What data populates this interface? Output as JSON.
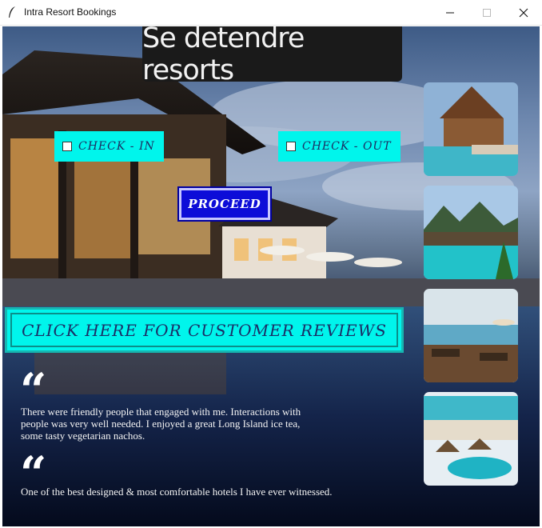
{
  "window": {
    "title": "Intra Resort Bookings",
    "icon": "feather-icon"
  },
  "header": {
    "title": "Se detendre resorts"
  },
  "buttons": {
    "check_in": "CHECK - IN",
    "check_out": "CHECK - OUT",
    "proceed": "PROCEED",
    "reviews": "CLICK HERE FOR CUSTOMER REVIEWS"
  },
  "reviews": [
    {
      "quote_mark": "“",
      "lines": [
        "There were friendly people that engaged with me. Interactions with",
        "people was very well needed. I enjoyed a great Long Island ice tea,",
        "some tasty vegetarian nachos."
      ]
    },
    {
      "quote_mark": "“",
      "lines": [
        "One of the best designed & most comfortable hotels I have ever witnessed."
      ]
    }
  ],
  "colors": {
    "accent_cyan": "#00f5ec",
    "proceed_blue": "#0d0dd8",
    "header_bg": "#1a1a1a"
  }
}
